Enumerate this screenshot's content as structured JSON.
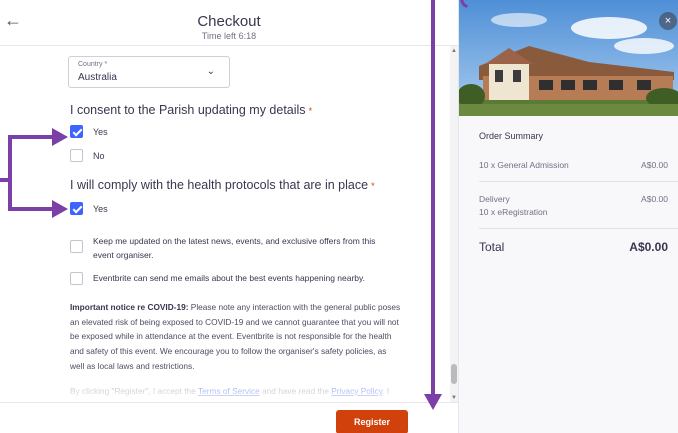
{
  "header": {
    "back_icon": "arrow-left-icon",
    "title": "Checkout",
    "subtitle": "Time left 6:18"
  },
  "form": {
    "country": {
      "label": "Country *",
      "value": "Australia",
      "chevron_icon": "chevron-down-icon"
    },
    "consent": {
      "question": "I consent to the Parish updating my details",
      "required_mark": "*",
      "options": [
        {
          "label": "Yes",
          "checked": true
        },
        {
          "label": "No",
          "checked": false
        }
      ]
    },
    "health": {
      "question": "I will comply with the health protocols that are in place",
      "required_mark": "*",
      "options": [
        {
          "label": "Yes",
          "checked": true
        }
      ]
    },
    "marketing": [
      {
        "label": "Keep me updated on the latest news, events, and exclusive offers from this event organiser.",
        "checked": false
      },
      {
        "label": "Eventbrite can send me emails about the best events happening nearby.",
        "checked": false
      }
    ],
    "notice": {
      "heading": "Important notice re COVID-19:",
      "body": " Please note any interaction with the general public poses an elevated risk of being exposed to COVID-19 and we cannot guarantee that you will not be exposed while in attendance at the event. Eventbrite is not responsible for the health and safety of this event. We encourage you to follow the organiser's safety policies, as well as local laws and restrictions."
    },
    "terms": {
      "prefix": "By clicking \"Register\", I accept the ",
      "terms_link": "Terms of Service",
      "middle": " and have read the ",
      "privacy_link": "Privacy Policy",
      "suffix": ". I"
    }
  },
  "footer": {
    "register_label": "Register"
  },
  "summary": {
    "close_icon": "close-icon",
    "title": "Order Summary",
    "lines": [
      {
        "label": "10 x General Admission",
        "amount": "A$0.00"
      },
      {
        "label": "Delivery",
        "sublabel": "10 x eRegistration",
        "amount": "A$0.00"
      }
    ],
    "total_label": "Total",
    "total_amount": "A$0.00"
  },
  "colors": {
    "accent_blue": "#3d64ff",
    "brand_orange": "#d1410c",
    "annotation_purple": "#7b3fa8"
  }
}
